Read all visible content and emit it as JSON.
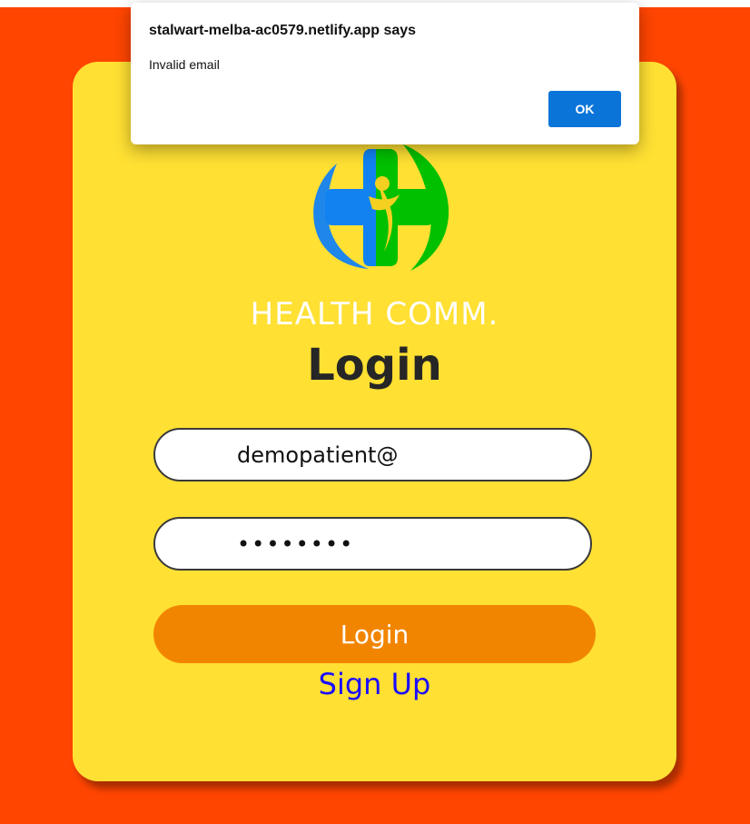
{
  "dialog": {
    "title": "stalwart-melba-ac0579.netlify.app says",
    "message": "Invalid email",
    "ok_label": "OK"
  },
  "brand": {
    "name": "HEALTH COMM.",
    "logo_icon": "health-cross-logo-icon",
    "colors": {
      "blue": "#1f86ea",
      "green": "#00c000",
      "yellow": "#f5d020"
    }
  },
  "form": {
    "title": "Login",
    "email_value": "demopatient@",
    "password_value": "********",
    "login_label": "Login",
    "signup_label": "Sign Up"
  },
  "theme": {
    "page_background": "#ff4500",
    "card_background": "#ffe033",
    "button_color": "#f28500",
    "link_color": "#1a0dff"
  }
}
